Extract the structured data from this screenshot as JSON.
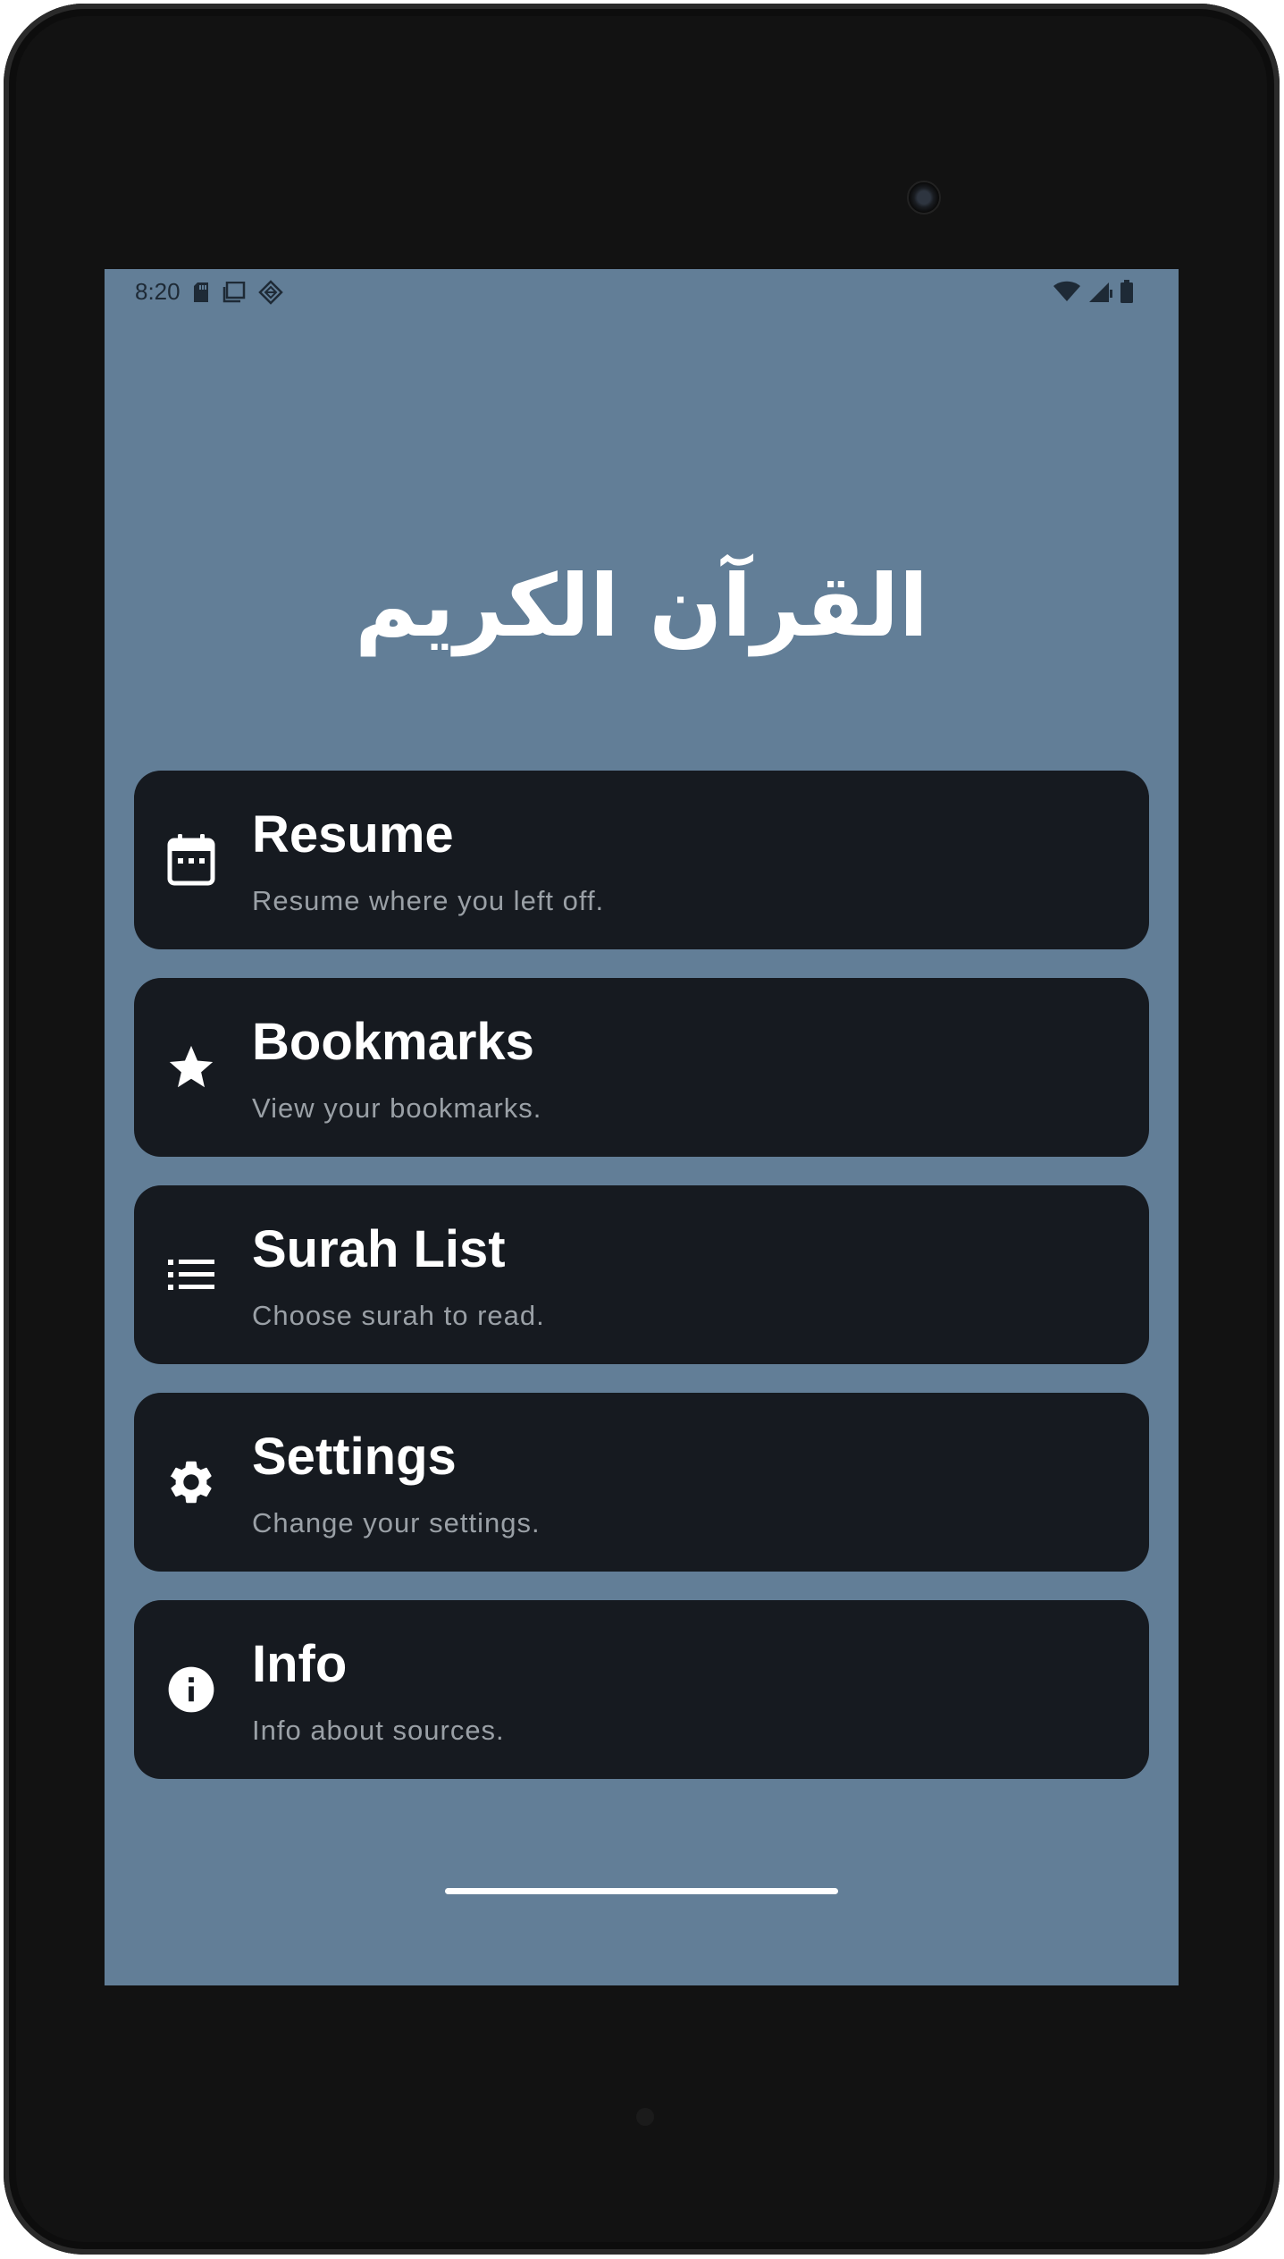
{
  "status_bar": {
    "time": "8:20",
    "left_icons": [
      "sd-card-icon",
      "screenshot-icon",
      "app-notification-icon"
    ],
    "right_icons": [
      "wifi-icon",
      "cell-signal-icon",
      "battery-icon"
    ]
  },
  "app": {
    "logo_text": "القرآن الكريم"
  },
  "menu": [
    {
      "icon": "calendar-icon",
      "title": "Resume",
      "subtitle": "Resume where you left off."
    },
    {
      "icon": "star-icon",
      "title": "Bookmarks",
      "subtitle": "View your bookmarks."
    },
    {
      "icon": "list-icon",
      "title": "Surah List",
      "subtitle": "Choose surah to read."
    },
    {
      "icon": "gear-icon",
      "title": "Settings",
      "subtitle": "Change your settings."
    },
    {
      "icon": "info-icon",
      "title": "Info",
      "subtitle": "Info about sources."
    }
  ],
  "colors": {
    "background": "#627e97",
    "card": "#161a20",
    "title": "#ffffff",
    "subtitle": "#9aa0a6"
  }
}
